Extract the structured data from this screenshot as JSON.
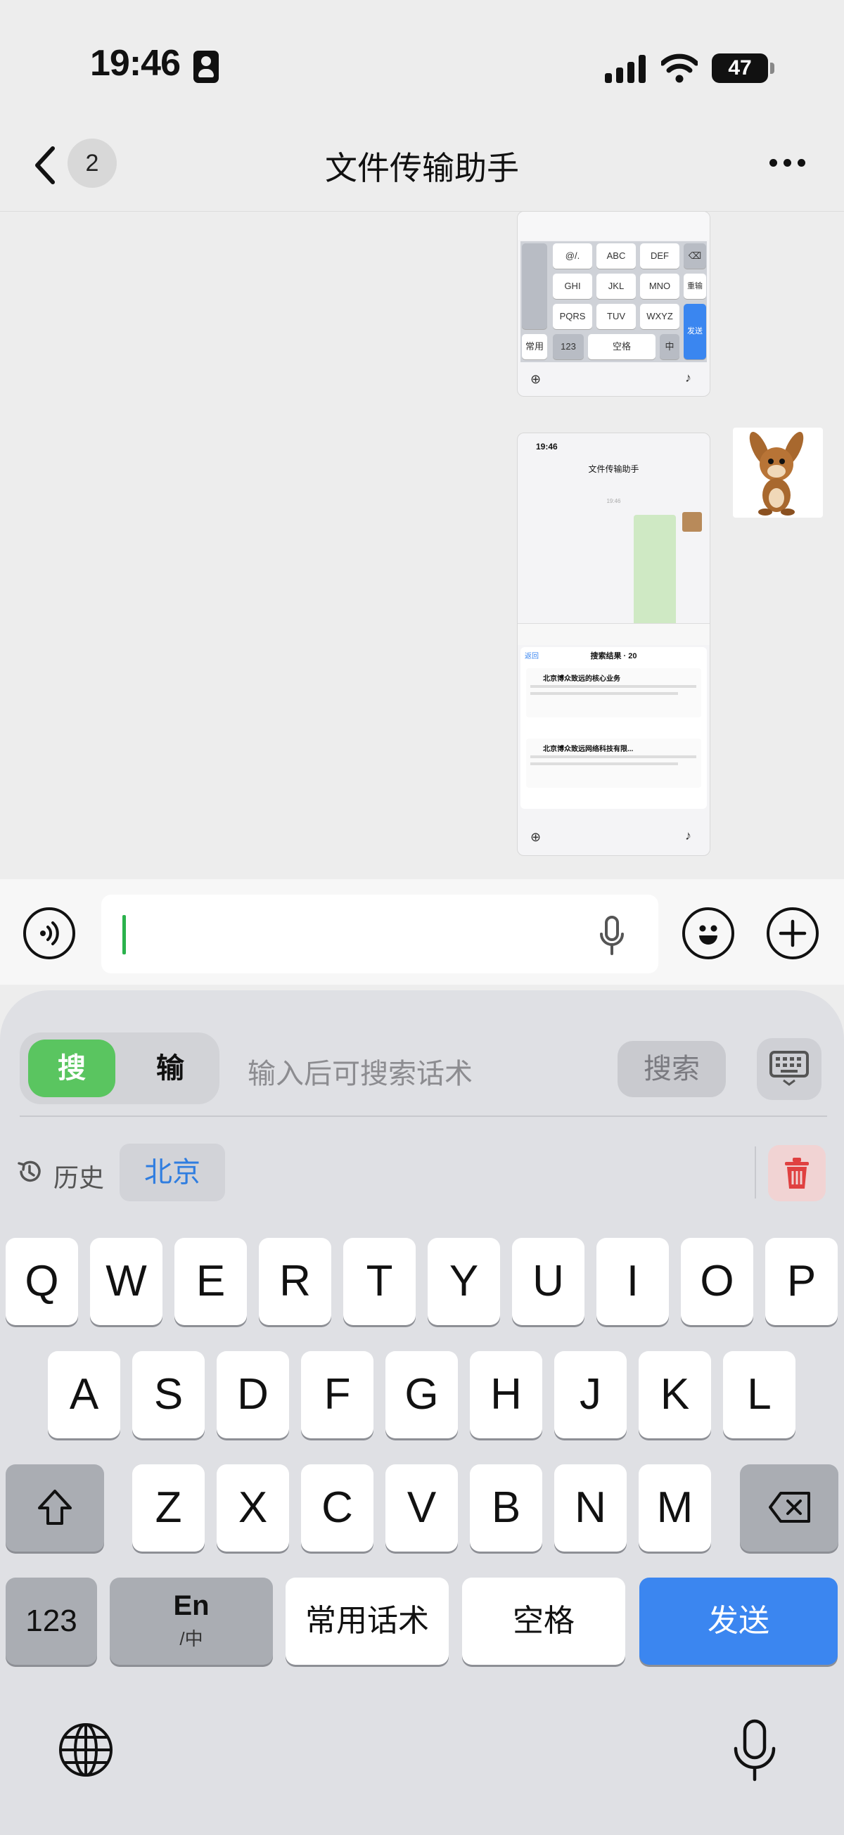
{
  "status_bar": {
    "time": "19:46",
    "battery": "47"
  },
  "nav": {
    "unread_count": "2",
    "title": "文件传输助手"
  },
  "chat": {
    "image1": {
      "keys": [
        {
          "label": "@/."
        },
        {
          "label": "ABC"
        },
        {
          "label": "DEF"
        },
        {
          "label": "GHI"
        },
        {
          "label": "JKL"
        },
        {
          "label": "MNO"
        },
        {
          "label": "PQRS"
        },
        {
          "label": "TUV"
        },
        {
          "label": "WXYZ"
        },
        {
          "label": "常用"
        },
        {
          "label": "123"
        },
        {
          "label": "空格"
        },
        {
          "label": "中"
        },
        {
          "label": "重输"
        },
        {
          "label": "发送"
        }
      ]
    },
    "image2": {
      "time": "19:46",
      "title": "文件传输助手",
      "msg_time": "19:46",
      "results_back": "返回",
      "results_title": "搜索结果 · 20",
      "result1": "北京博众致远的核心业务",
      "result2": "北京博众致远网络科技有限..."
    }
  },
  "keyboard": {
    "mode_search": "搜",
    "mode_type": "输",
    "search_placeholder": "输入后可搜索话术",
    "search_button": "搜索",
    "history_label": "历史",
    "history_chip": "北京",
    "row1": [
      "Q",
      "W",
      "E",
      "R",
      "T",
      "Y",
      "U",
      "I",
      "O",
      "P"
    ],
    "row2": [
      "A",
      "S",
      "D",
      "F",
      "G",
      "H",
      "J",
      "K",
      "L"
    ],
    "row3": [
      "Z",
      "X",
      "C",
      "V",
      "B",
      "N",
      "M"
    ],
    "numbers_key": "123",
    "en_key_main": "En",
    "en_key_sub": "/中",
    "phrases_key": "常用话术",
    "space_key": "空格",
    "send_key": "发送"
  },
  "colors": {
    "accent_green": "#5ac560",
    "send_blue": "#3b86f0",
    "chip_blue": "#2f7de0",
    "trash_red": "#e04040"
  }
}
